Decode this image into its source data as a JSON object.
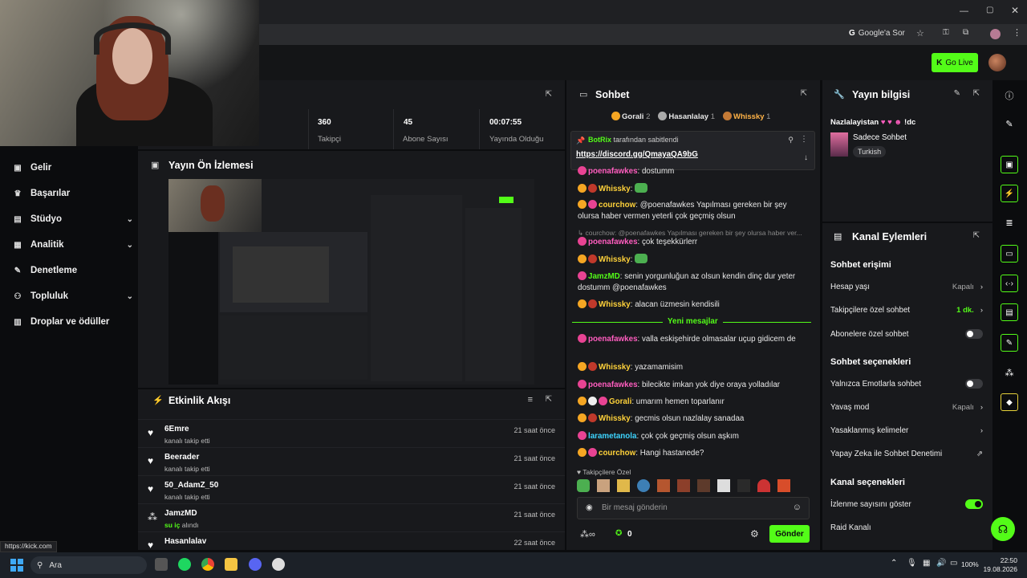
{
  "browser": {
    "google_sor": "Google'a Sor",
    "status_url": "https://kick.com"
  },
  "header": {
    "go_live": "Go Live"
  },
  "sidebar": {
    "items": [
      {
        "label": "Gelir",
        "icon": "money-icon",
        "chevron": false
      },
      {
        "label": "Başarılar",
        "icon": "trophy-icon",
        "chevron": false
      },
      {
        "label": "Stüdyo",
        "icon": "studio-icon",
        "chevron": true
      },
      {
        "label": "Analitik",
        "icon": "analytics-icon",
        "chevron": true
      },
      {
        "label": "Denetleme",
        "icon": "wrench-icon",
        "chevron": false
      },
      {
        "label": "Topluluk",
        "icon": "community-icon",
        "chevron": true
      },
      {
        "label": "Droplar ve ödüller",
        "icon": "drops-icon",
        "chevron": false
      }
    ]
  },
  "stats": {
    "followers_value": "360",
    "followers_label": "Takipçi",
    "subs_value": "45",
    "subs_label": "Abone Sayısı",
    "uptime_value": "00:07:55",
    "uptime_label": "Yayında Olduğu Süre"
  },
  "preview": {
    "title": "Yayın Ön İzlemesi"
  },
  "activity": {
    "title": "Etkinlik Akışı",
    "items": [
      {
        "name": "6Emre",
        "sub": "kanalı takip etti",
        "time": "21 saat önce",
        "icon": "heart-icon"
      },
      {
        "name": "Beerader",
        "sub": "kanalı takip etti",
        "time": "21 saat önce",
        "icon": "heart-icon"
      },
      {
        "name": "50_AdamZ_50",
        "sub": "kanalı takip etti",
        "time": "21 saat önce",
        "icon": "heart-icon"
      },
      {
        "name": "JamzMD",
        "sub_highlight": "su iç",
        "sub": "alındı",
        "time": "21 saat önce",
        "icon": "points-icon"
      },
      {
        "name": "Hasanlalav",
        "sub": "",
        "time": "22 saat önce",
        "icon": "heart-icon"
      }
    ]
  },
  "chat": {
    "title": "Sohbet",
    "leaders": [
      {
        "name": "Gorali",
        "count": "2"
      },
      {
        "name": "Hasanlalay",
        "count": "1"
      },
      {
        "name": "Whissky",
        "count": "1"
      }
    ],
    "pinned_by": "BotRix",
    "pinned_suffix": "tarafından sabitlendi",
    "pinned_link": "https://discord.gg/QmayaQA9bG",
    "messages": [
      {
        "user": "poenafawkes",
        "text": "dostumm",
        "cls": "u-pink"
      },
      {
        "user": "Whissky",
        "text": "",
        "cls": "u-gold",
        "emote": true
      },
      {
        "user": "courchow",
        "text": "@poenafawkes Yapılması gereken bir şey olursa haber vermen yeterli çok geçmiş olsun",
        "cls": "u-gold"
      },
      {
        "reply": "courchow: @poenafawkes Yapılması gereken bir şey olursa haber ver..."
      },
      {
        "user": "poenafawkes",
        "text": "çok teşekkürlerr",
        "cls": "u-pink"
      },
      {
        "user": "Whissky",
        "text": "",
        "cls": "u-gold",
        "emote": true
      },
      {
        "user": "JamzMD",
        "text": "senin yorgunluğun az olsun kendin dinç dur yeter dostumm @poenafawkes",
        "cls": "u-green"
      },
      {
        "user": "Whissky",
        "text": "alacan üzmesin kendisili",
        "cls": "u-gold"
      },
      {
        "user": "poenafawkes",
        "text": "valla eskişehirde olmasalar uçup gidicem de",
        "cls": "u-pink"
      },
      {
        "user": "Whissky",
        "text": "yazamamisim",
        "cls": "u-gold"
      },
      {
        "user": "poenafawkes",
        "text": "bilecikte imkan yok diye oraya yolladılar",
        "cls": "u-pink"
      },
      {
        "user": "Gorali",
        "text": "umarım hemen toparlanır",
        "cls": "u-gold"
      },
      {
        "user": "Whissky",
        "text": "gecmis olsun nazlalay sanadaa",
        "cls": "u-gold"
      },
      {
        "user": "larametanola",
        "text": "çok çok geçmiş olsun aşkım",
        "cls": "u-teal"
      },
      {
        "user": "courchow",
        "text": "Hangi hastanede?",
        "cls": "u-gold"
      }
    ],
    "new_messages": "Yeni mesajlar",
    "followers_only": "Takipçilere Özel",
    "input_placeholder": "Bir mesaj gönderin",
    "points": "0",
    "send": "Gönder"
  },
  "info": {
    "title": "Yayın bilgisi",
    "stream_title": "Nazlalayistan",
    "stream_title_suffix": "!dc",
    "category": "Sadece Sohbet",
    "tag": "Turkish"
  },
  "actions": {
    "title": "Kanal Eylemleri",
    "chat_access": "Sohbet erişimi",
    "account_age": "Hesap yaşı",
    "account_age_val": "Kapalı",
    "followers_chat": "Takipçilere özel sohbet",
    "followers_chat_val": "1 dk.",
    "subs_chat": "Abonelere özel sohbet",
    "chat_options": "Sohbet seçenekleri",
    "emote_only": "Yalnızca Emotlarla sohbet",
    "slow_mode": "Yavaş mod",
    "slow_mode_val": "Kapalı",
    "banned_words": "Yasaklanmış kelimeler",
    "ai_moderation": "Yapay Zeka ile Sohbet Denetimi",
    "channel_options": "Kanal seçenekleri",
    "show_viewers": "İzlenme sayısını göster",
    "raid": "Raid Kanalı"
  },
  "taskbar": {
    "search": "Ara",
    "battery": "100%",
    "time": "22:50",
    "date": "19.08.2026"
  },
  "colors": {
    "accent": "#53fc18",
    "panel": "#18191c",
    "bg": "#0b0c0e"
  }
}
